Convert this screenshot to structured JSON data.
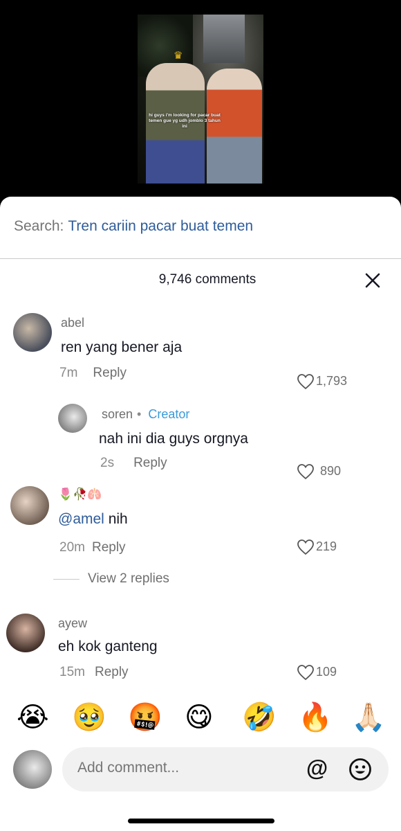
{
  "video": {
    "caption": "hi guys i'm looking for pacar buat temen gue yg udh jomblo 3 tahun ini"
  },
  "search": {
    "label": "Search:",
    "term": "Tren cariin pacar buat temen"
  },
  "comments_header": {
    "count": "9,746 comments"
  },
  "comments": [
    {
      "user": "abel",
      "text": "ren yang bener aja",
      "time": "7m",
      "reply": "Reply",
      "likes": "1,793"
    },
    {
      "user": "soren",
      "badge": "Creator",
      "text": "nah ini dia guys orgnya",
      "time": "2s",
      "reply": "Reply",
      "likes": "890"
    },
    {
      "user": "🌷🥀🫁",
      "mention": "@amel",
      "text": "nih",
      "time": "20m",
      "reply": "Reply",
      "likes": "219"
    },
    {
      "user": "ayew",
      "text": "eh kok ganteng",
      "time": "15m",
      "reply": "Reply",
      "likes": "109"
    }
  ],
  "view_replies": "View 2 replies",
  "emojis": [
    "😭",
    "🥹",
    "🤬",
    "😋",
    "🤣",
    "🔥",
    "🙏🏻"
  ],
  "composer": {
    "placeholder": "Add comment...",
    "at_symbol": "@"
  }
}
